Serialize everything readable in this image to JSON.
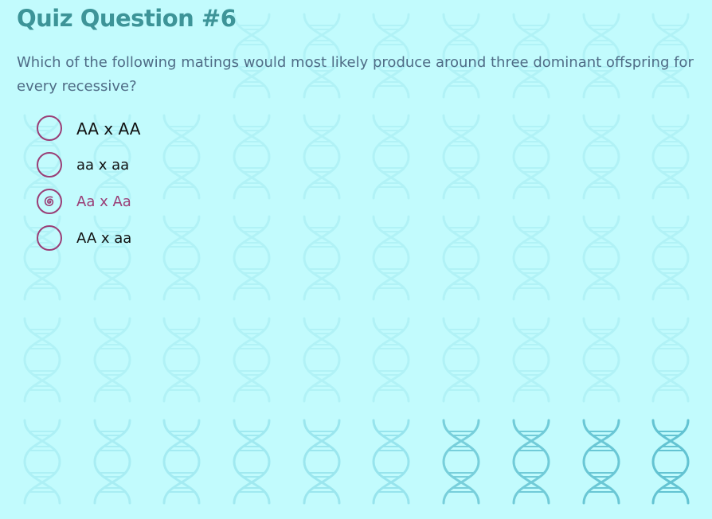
{
  "quiz": {
    "title": "Quiz Question #6",
    "question": "Which of the following matings would most likely produce around three dominant offspring for every recessive?",
    "options": [
      {
        "label": "AA x AA",
        "selected": false
      },
      {
        "label": "aa x aa",
        "selected": false
      },
      {
        "label": "Aa x Aa",
        "selected": true
      },
      {
        "label": "AA x aa",
        "selected": false
      }
    ]
  },
  "theme": {
    "background": "#c2fbfd",
    "title_color": "#3d9498",
    "question_color": "#4f6c86",
    "accent": "#9a3e76",
    "background_icon": "dna-helix-icon"
  }
}
